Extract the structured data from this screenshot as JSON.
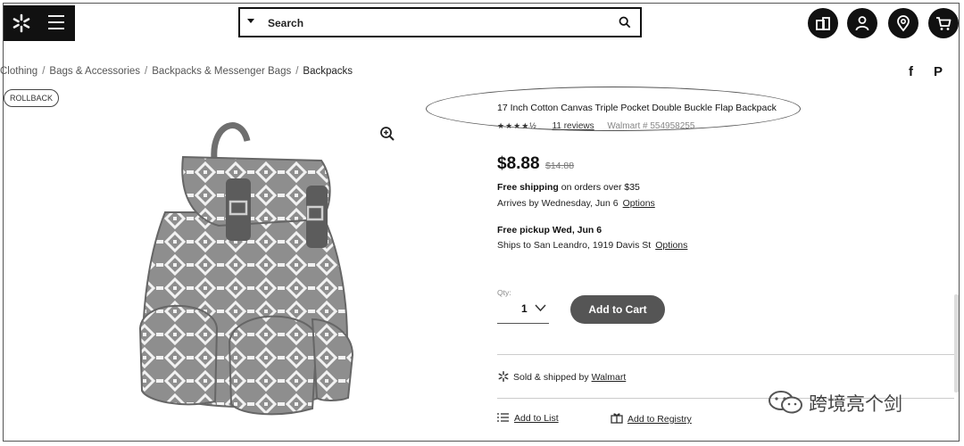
{
  "header": {
    "search_placeholder": "Search",
    "icons": [
      "spark-logo-icon",
      "menu-icon",
      "search-icon",
      "reorder-icon",
      "account-icon",
      "location-icon",
      "cart-icon"
    ]
  },
  "breadcrumb": {
    "items": [
      "Clothing",
      "Bags & Accessories",
      "Backpacks & Messenger Bags",
      "Backpacks"
    ],
    "separator": "/"
  },
  "share": {
    "facebook": "f",
    "pinterest": "P"
  },
  "badge": "ROLLBACK",
  "product": {
    "title": "17 Inch Cotton Canvas Triple Pocket Double Buckle Flap Backpack",
    "stars": "★★★★½",
    "rating_value": 4.5,
    "reviews": "11 reviews",
    "walmart_no": "Walmart # 554958255",
    "price": "$8.88",
    "old_price": "$14.88",
    "shipping": {
      "free": "Free shipping",
      "rest": " on orders over $35"
    },
    "arrives": "Arrives by Wednesday, Jun 6",
    "options": "Options",
    "pickup": "Free pickup Wed, Jun 6",
    "ships_to": "Ships to San Leandro, 1919 Davis St",
    "qty_label": "Qty:",
    "qty": "1",
    "add_to_cart": "Add to Cart",
    "sold_by_prefix": "Sold & shipped by ",
    "seller": "Walmart",
    "add_to_list": "Add to List",
    "add_to_registry": "Add to Registry"
  },
  "watermark": "跨境亮个剑",
  "colors": {
    "accent": "#111111",
    "button": "#555555"
  }
}
